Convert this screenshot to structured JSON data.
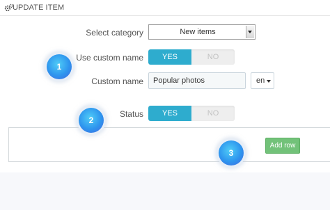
{
  "header": {
    "title": "UPDATE ITEM",
    "icon": "gears-icon"
  },
  "form": {
    "category_label": "Select category",
    "category_value": "New items",
    "use_custom_label": "Use custom name",
    "use_custom_yes": "YES",
    "use_custom_no": "NO",
    "use_custom_selected": "YES",
    "custom_name_label": "Custom name",
    "custom_name_value": "Popular photos",
    "language": "en",
    "status_label": "Status",
    "status_yes": "YES",
    "status_no": "NO",
    "status_selected": "YES",
    "add_row_label": "Add row"
  },
  "badges": [
    "1",
    "2",
    "3"
  ],
  "colors": {
    "toggle_active": "#2eacce",
    "add_row": "#72c279",
    "badge": "#2e95ee"
  }
}
